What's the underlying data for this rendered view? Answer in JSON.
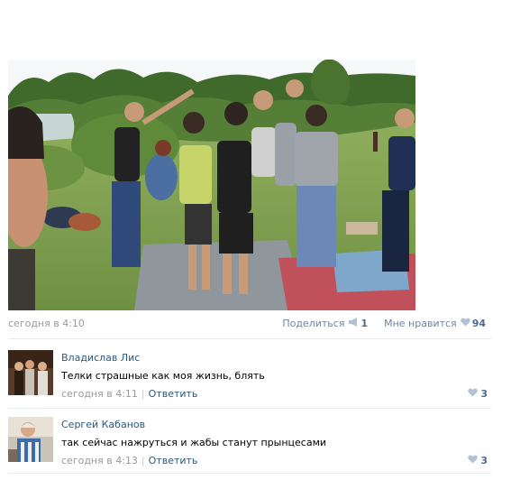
{
  "post": {
    "photo_icon": "group-photo",
    "date": "сегодня в 4:10",
    "share_label": "Поделиться",
    "share_icon": "megaphone-icon",
    "share_count": "1",
    "like_label": "Мне нравится",
    "like_icon": "heart-icon",
    "like_count": "94"
  },
  "comments": [
    {
      "author": "Владислав Лис",
      "text": "Телки страшные как моя жизнь, блять",
      "date": "сегодня в 4:11",
      "reply_label": "Ответить",
      "like_count": "3"
    },
    {
      "author": "Сергей Кабанов",
      "text": "так сейчас нажруться и жабы станут прынцесами",
      "date": "сегодня в 4:13",
      "reply_label": "Ответить",
      "like_count": "3"
    }
  ],
  "colors": {
    "link": "#2b587a",
    "muted": "#999999",
    "count": "#4f6b8a",
    "divider": "#e7eaed"
  }
}
